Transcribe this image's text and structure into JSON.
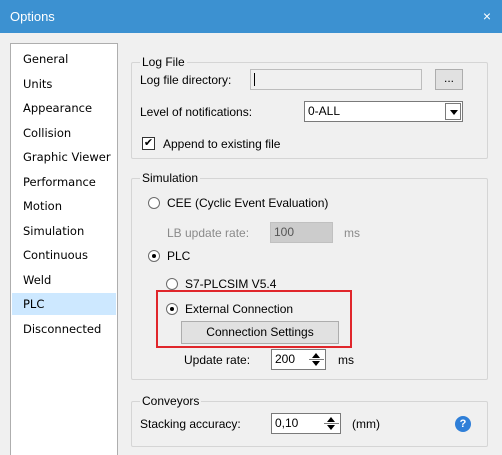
{
  "window": {
    "title": "Options",
    "close_glyph": "×"
  },
  "sidebar": {
    "items": [
      {
        "label": "General"
      },
      {
        "label": "Units"
      },
      {
        "label": "Appearance"
      },
      {
        "label": "Collision"
      },
      {
        "label": "Graphic Viewer"
      },
      {
        "label": "Performance"
      },
      {
        "label": "Motion"
      },
      {
        "label": "Simulation"
      },
      {
        "label": "Continuous"
      },
      {
        "label": "Weld"
      },
      {
        "label": "PLC",
        "selected": true
      },
      {
        "label": "Disconnected"
      }
    ]
  },
  "log_file": {
    "group_title": "Log File",
    "directory_label": "Log file directory:",
    "directory_value": "",
    "browse_label": "...",
    "notifications_label": "Level of notifications:",
    "notifications_value": "0-ALL",
    "append_label": "Append to existing file",
    "append_checked": true,
    "check_glyph": "✔"
  },
  "simulation": {
    "group_title": "Simulation",
    "cee_label": "CEE (Cyclic Event Evaluation)",
    "cee_selected": false,
    "lb_update_label": "LB update rate:",
    "lb_update_value": "100",
    "lb_update_unit": "ms",
    "plc_label": "PLC",
    "plc_selected": true,
    "s7_label": "S7-PLCSIM V5.4",
    "s7_selected": false,
    "external_label": "External Connection",
    "external_selected": true,
    "connection_settings_label": "Connection Settings",
    "update_rate_label": "Update rate:",
    "update_rate_value": "200",
    "update_rate_unit": "ms"
  },
  "conveyors": {
    "group_title": "Conveyors",
    "stacking_label": "Stacking accuracy:",
    "stacking_value": "0,10",
    "stacking_unit": "(mm)",
    "help_glyph": "?"
  },
  "colors": {
    "titlebar": "#3c91d1",
    "selection": "#cde8ff",
    "highlight_box": "#e0262b",
    "help_icon": "#2f7fd8"
  }
}
